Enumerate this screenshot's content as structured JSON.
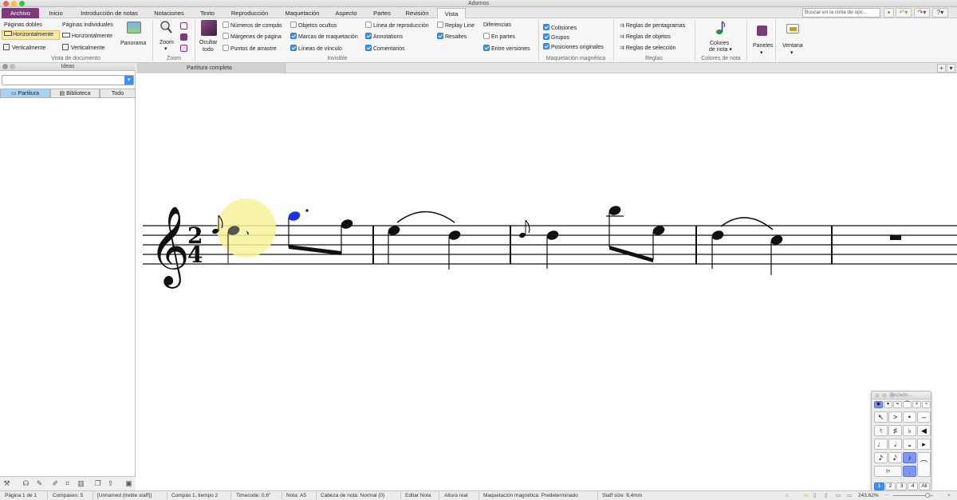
{
  "window": {
    "title": "Adornos"
  },
  "colors": {
    "file_tab": "#7a3c78",
    "accent": "#3b8ff5",
    "selected_note": "#1f34e0",
    "highlight": "#f7f39a",
    "keypad_selected": "#7e97f3"
  },
  "tabs": [
    "Archivo",
    "Inicio",
    "Introducción de notas",
    "Notaciones",
    "Texto",
    "Reproducción",
    "Maquetación",
    "Aspecto",
    "Partes",
    "Revisión",
    "Vista"
  ],
  "search": {
    "placeholder": "Buscar en la cinta de opc..."
  },
  "quick_access": [
    "save-icon",
    "undo-icon",
    "redo-icon",
    "help-icon"
  ],
  "ribbon": {
    "vista_documento": {
      "label": "Vista de documento",
      "paginas_dobles": "Páginas dobles",
      "horizontal_1": "Horizontalmente",
      "vertical_1": "Verticalmente",
      "paginas_individuales": "Páginas individuales",
      "horizontal_2": "Horizontalmente",
      "vertical_2": "Verticalmente",
      "panorama": "Panorama"
    },
    "zoom": {
      "label": "Zoom",
      "zoom_btn": "Zoom"
    },
    "invisible": {
      "label": "Invisible",
      "ocultar": "Ocultar",
      "todo": "todo",
      "items": [
        {
          "text": "Números de compás",
          "checked": false
        },
        {
          "text": "Márgenes de página",
          "checked": false
        },
        {
          "text": "Puntos de arrastre",
          "checked": false
        },
        {
          "text": "Objetos ocultos",
          "checked": false
        },
        {
          "text": "Marcas de maquetación",
          "checked": true
        },
        {
          "text": "Líneas de vínculo",
          "checked": true
        },
        {
          "text": "Línea de reproducción",
          "checked": false
        },
        {
          "text": "Annotations",
          "checked": true
        },
        {
          "text": "Comentarios",
          "checked": true
        },
        {
          "text": "Replay Line",
          "checked": false
        },
        {
          "text": "Resaltes",
          "checked": true
        }
      ]
    },
    "diferencias": {
      "title": "Diferencias",
      "items": [
        {
          "text": "En partes",
          "checked": false
        },
        {
          "text": "Entre versiones",
          "checked": true
        }
      ]
    },
    "maquetacion": {
      "label": "Maquetación magnética",
      "items": [
        {
          "text": "Colisiones",
          "checked": true
        },
        {
          "text": "Grupos",
          "checked": true
        },
        {
          "text": "Posiciones originales",
          "checked": true
        }
      ]
    },
    "reglas": {
      "label": "Reglas",
      "items": [
        "Reglas de pentagramas",
        "Reglas de objetos",
        "Reglas de selección"
      ]
    },
    "colores": {
      "label": "Colores de nota",
      "btn1": "Colores",
      "btn2": "de nota"
    },
    "paneles": {
      "btn": "Paneles"
    },
    "ventana": {
      "btn": "Ventana"
    }
  },
  "left_panel": {
    "title": "Ideas",
    "tabs": [
      "Partitura",
      "Biblioteca",
      "Todo"
    ]
  },
  "document": {
    "tab_label": "Partitura completa"
  },
  "score": {
    "clef": "treble",
    "time_signature": {
      "numerator": "2",
      "denominator": "4"
    },
    "measures": 5,
    "selected_note": "A5"
  },
  "status": {
    "items": [
      "Página 1 de 1",
      "Compases: 5",
      "[Unnamed (treble staff)]",
      "Compás 1, tiempo 2",
      "Timecode: 0,6\"",
      "Nota: A5",
      "Cabeza de nota: Normal (0)",
      "Editar Nota",
      "Altura real",
      "Maquetación magnética: Predeterminado",
      "Staff size: 8,4mm"
    ],
    "zoom": "243,62%"
  },
  "keypad": {
    "title": "Teclado",
    "layouts": [
      "1",
      "2",
      "3",
      "4",
      "All"
    ],
    "selected_layout": "1"
  }
}
